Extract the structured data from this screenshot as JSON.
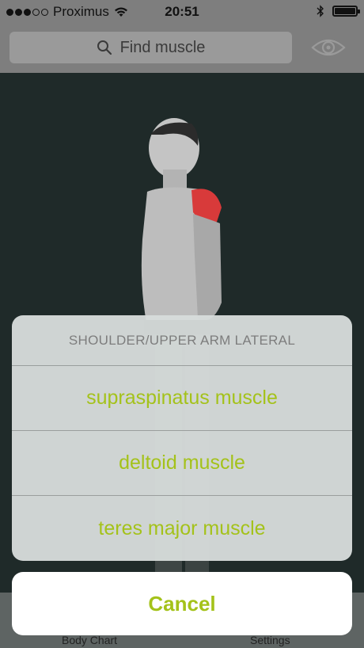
{
  "status_bar": {
    "carrier": "Proximus",
    "time": "20:51",
    "signal_filled": 3,
    "signal_total": 5,
    "battery_level": 1.0
  },
  "header": {
    "search_placeholder": "Find muscle"
  },
  "tab_bar": {
    "left_label": "Body Chart",
    "right_label": "Settings"
  },
  "action_sheet": {
    "title": "SHOULDER/UPPER ARM LATERAL",
    "options": [
      "supraspinatus muscle",
      "deltoid muscle",
      "teres major muscle"
    ],
    "cancel_label": "Cancel"
  },
  "colors": {
    "accent": "#a4c21a",
    "highlight": "#d83a3a",
    "background": "#1f2a29"
  },
  "icons": [
    "wifi-icon",
    "bluetooth-icon",
    "battery-icon",
    "search-icon",
    "eye-icon"
  ]
}
